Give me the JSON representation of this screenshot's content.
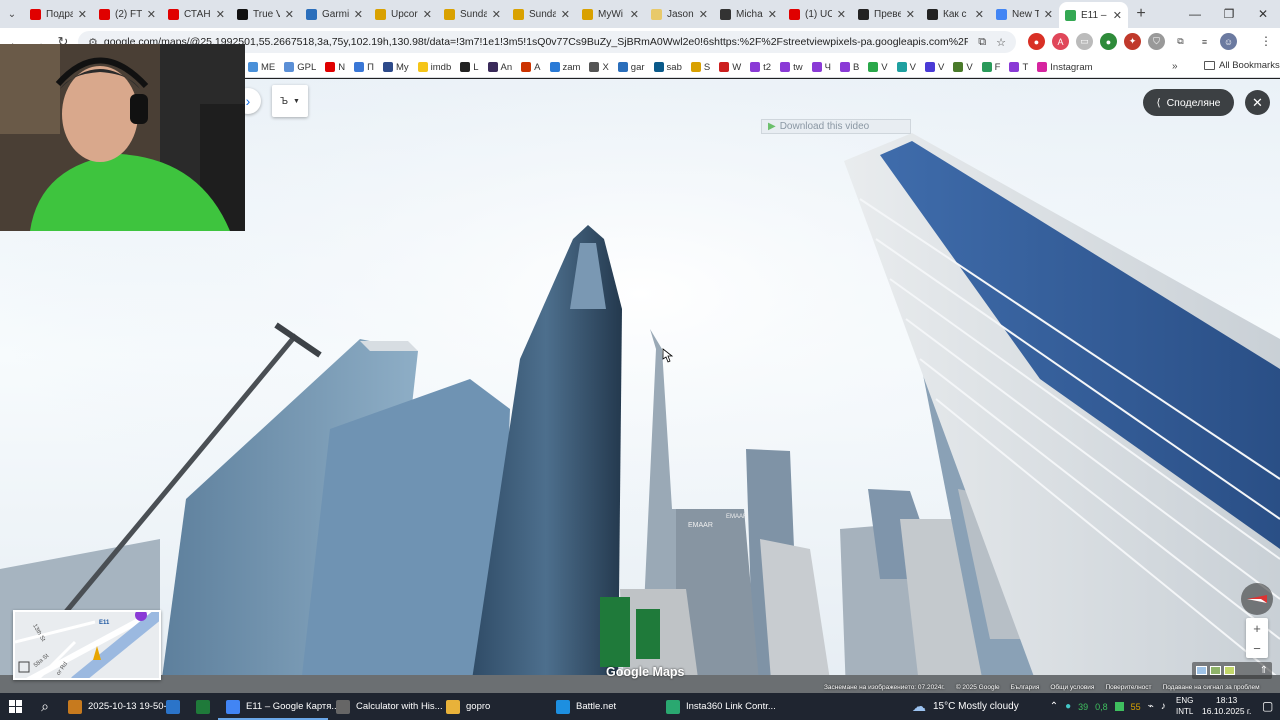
{
  "browser": {
    "tabs": [
      {
        "title": "Подра",
        "icon": "youtube-icon",
        "color": "#e00000"
      },
      {
        "title": "(2) FTI",
        "icon": "youtube-icon",
        "color": "#e00000"
      },
      {
        "title": "СТАН",
        "icon": "youtube-icon",
        "color": "#e00000"
      },
      {
        "title": "True V",
        "icon": "globe-icon",
        "color": "#111111"
      },
      {
        "title": "Garmi",
        "icon": "garmin-icon",
        "color": "#2a6ebb"
      },
      {
        "title": "Upcor",
        "icon": "sun-icon",
        "color": "#d9a100"
      },
      {
        "title": "Sunda",
        "icon": "sun-icon",
        "color": "#d9a100"
      },
      {
        "title": "Sunda",
        "icon": "sun-icon",
        "color": "#d9a100"
      },
      {
        "title": "MyWi",
        "icon": "sun-icon",
        "color": "#d9a100"
      },
      {
        "title": "Jason",
        "icon": "sun-icon",
        "color": "#e8c96a"
      },
      {
        "title": "Micha",
        "icon": "wikipedia-icon",
        "color": "#333333"
      },
      {
        "title": "(1) UC",
        "icon": "youtube-icon",
        "color": "#e00000"
      },
      {
        "title": "Преве",
        "icon": "openai-icon",
        "color": "#222222"
      },
      {
        "title": "Как с",
        "icon": "openai-icon",
        "color": "#222222"
      },
      {
        "title": "New T",
        "icon": "chrome-icon",
        "color": "#4285f4"
      },
      {
        "title": "E11 –",
        "icon": "maps-pin-icon",
        "color": "#34a853",
        "active": true
      }
    ],
    "url": "google.com/maps/@25.1992501,55.2667518,3a,75y,102.19h,130.98t/data=!3m7!1e1!3m5!1sQ0v77Cs9BuZy_SjBRmA0Wwl2e0!6shttps:%2F%2Fstreetviewpixels-pa.googleapis.com%2Fv1%2Fthumbnail%3Fcb_cli...",
    "bookmarks": [
      {
        "label": "ME",
        "color": "#4a90d9"
      },
      {
        "label": "GPL",
        "color": "#5b8fd6"
      },
      {
        "label": "N",
        "color": "#e00000"
      },
      {
        "label": "П",
        "color": "#3a77d6"
      },
      {
        "label": "My",
        "color": "#2d4a8a"
      },
      {
        "label": "imdb",
        "color": "#f5c518"
      },
      {
        "label": "L",
        "color": "#222222"
      },
      {
        "label": "An",
        "color": "#3a2a5a"
      },
      {
        "label": "A",
        "color": "#cc3300"
      },
      {
        "label": "zam",
        "color": "#2a7ad6"
      },
      {
        "label": "X",
        "color": "#555555"
      },
      {
        "label": "gar",
        "color": "#2a6ebb"
      },
      {
        "label": "sab",
        "color": "#0a5a8a"
      },
      {
        "label": "S",
        "color": "#d9a100"
      },
      {
        "label": "W",
        "color": "#cc1f1f"
      },
      {
        "label": "t2",
        "color": "#8a3ad6"
      },
      {
        "label": "tw",
        "color": "#8a3ad6"
      },
      {
        "label": "Ч",
        "color": "#8a3ad6"
      },
      {
        "label": "В",
        "color": "#8a3ad6"
      },
      {
        "label": "V",
        "color": "#2aa84a"
      },
      {
        "label": "V",
        "color": "#1fa0a0"
      },
      {
        "label": "V",
        "color": "#4a3ad6"
      },
      {
        "label": "V",
        "color": "#4a7a2a"
      },
      {
        "label": "F",
        "color": "#2a9a5a"
      },
      {
        "label": "T",
        "color": "#8a3ad6"
      },
      {
        "label": "Instagram",
        "color": "#d6249f"
      }
    ],
    "all_bookmarks": "All Bookmarks"
  },
  "streetview": {
    "share_label": "Споделяне",
    "download_video": "Download this video",
    "lang_button": "Ъ",
    "minimap": {
      "labels": [
        "13th St",
        "58a St",
        "or Rd"
      ],
      "road": "E11"
    },
    "logo": "Google Maps",
    "attribution": [
      "Заснемане на изображението: 07.2024г.",
      "© 2025 Google",
      "България",
      "Общи условия",
      "Поверителност",
      "Подаване на сигнал за проблем"
    ],
    "building_sign_1": "EMAAR",
    "building_sign_2": "EMAAR"
  },
  "taskbar": {
    "apps": [
      {
        "label": "2025-10-13 19-50-4...",
        "color": "#c77a1e"
      },
      {
        "label": "",
        "color": "#2b74c9"
      },
      {
        "label": "",
        "color": "#1f7a3a"
      },
      {
        "label": "E11 – Google Картя...",
        "color": "#4285f4",
        "active": true
      },
      {
        "label": "Calculator with His...",
        "color": "#666666"
      },
      {
        "label": "gopro",
        "color": "#e8b23a"
      },
      {
        "label": "Battle.net",
        "color": "#1d8fe0"
      },
      {
        "label": "Insta360 Link Contr...",
        "color": "#2aa870"
      }
    ],
    "weather": "15°C  Mostly cloudy",
    "tray_numbers": [
      "39",
      "0,8",
      "55"
    ],
    "lang": [
      "ENG",
      "INTL"
    ],
    "time": "18:13",
    "date": "16.10.2025 г."
  }
}
